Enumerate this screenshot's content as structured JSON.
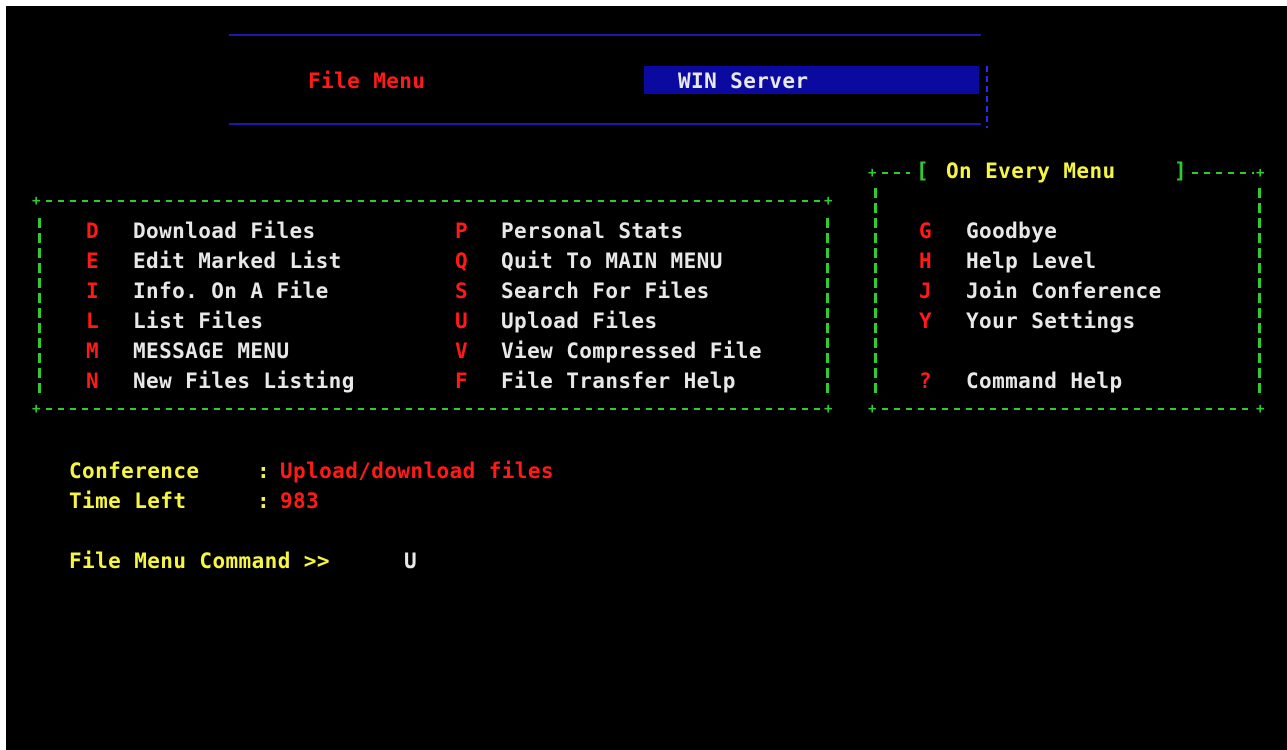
{
  "header": {
    "menu_title": "File Menu",
    "server_name": "WIN Server"
  },
  "main_menu": {
    "left": [
      {
        "key": "D",
        "label": "Download Files"
      },
      {
        "key": "E",
        "label": "Edit Marked List"
      },
      {
        "key": "I",
        "label": "Info. On A File"
      },
      {
        "key": "L",
        "label": "List Files"
      },
      {
        "key": "M",
        "label": "MESSAGE MENU"
      },
      {
        "key": "N",
        "label": "New Files Listing"
      }
    ],
    "right": [
      {
        "key": "P",
        "label": "Personal Stats"
      },
      {
        "key": "Q",
        "label": "Quit To MAIN MENU"
      },
      {
        "key": "S",
        "label": "Search For Files"
      },
      {
        "key": "U",
        "label": "Upload Files"
      },
      {
        "key": "V",
        "label": "View Compressed File"
      },
      {
        "key": "F",
        "label": "File Transfer Help"
      }
    ]
  },
  "every_menu": {
    "title": "On Every Menu",
    "bracket_open": "[",
    "bracket_close": "]",
    "items": [
      {
        "key": "G",
        "label": "Goodbye"
      },
      {
        "key": "H",
        "label": "Help Level"
      },
      {
        "key": "J",
        "label": "Join Conference"
      },
      {
        "key": "Y",
        "label": "Your Settings"
      },
      {
        "key": "?",
        "label": "Command Help"
      }
    ]
  },
  "status": {
    "conference_label": "Conference",
    "conference_value": "Upload/download files",
    "time_left_label": "Time Left",
    "time_left_value": "983",
    "separator": ":"
  },
  "prompt": {
    "label": "File Menu Command >>",
    "input": "U"
  },
  "colors": {
    "background": "#000000",
    "hotkey": "#ff1a1a",
    "label": "#e8e8e8",
    "accent_yellow": "#f5f542",
    "border_green": "#2ecc2e",
    "header_blue": "#0a0aa0"
  }
}
